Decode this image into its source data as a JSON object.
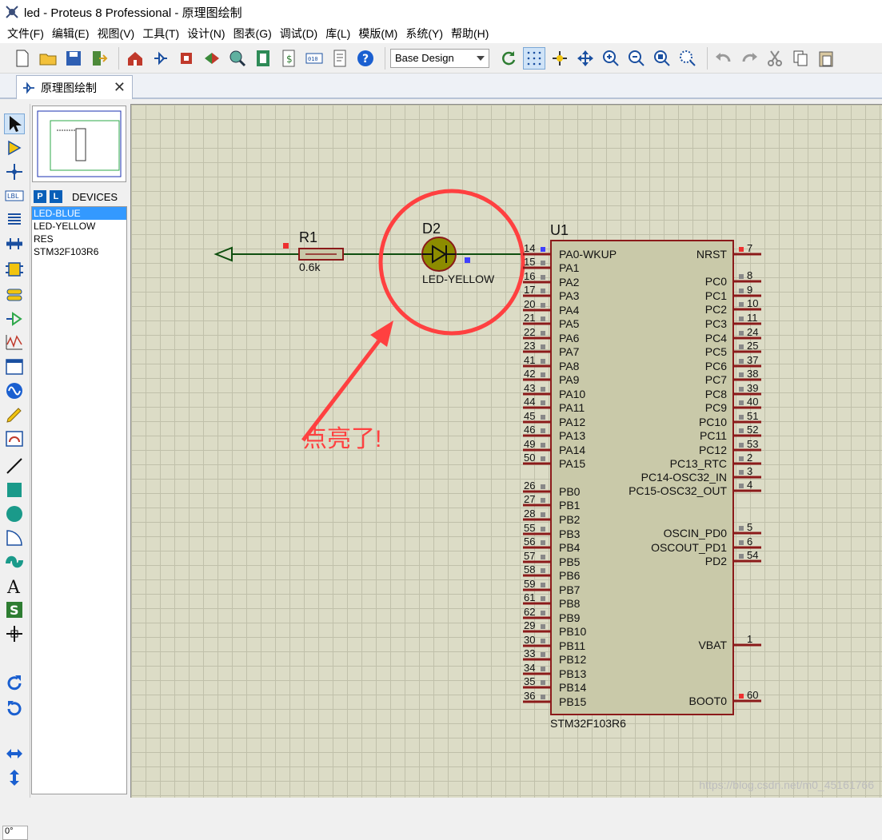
{
  "window": {
    "title": "led - Proteus 8 Professional - 原理图绘制"
  },
  "menu": [
    "文件(F)",
    "编辑(E)",
    "视图(V)",
    "工具(T)",
    "设计(N)",
    "图表(G)",
    "调试(D)",
    "库(L)",
    "模版(M)",
    "系统(Y)",
    "帮助(H)"
  ],
  "toolbar": {
    "design_combo": "Base Design"
  },
  "tab": {
    "label": "原理图绘制",
    "close": "✕"
  },
  "devices": {
    "p_btn": "P",
    "l_btn": "L",
    "header": "DEVICES",
    "items": [
      "LED-BLUE",
      "LED-YELLOW",
      "RES",
      "STM32F103R6"
    ]
  },
  "angle": "0°",
  "schematic": {
    "r1_ref": "R1",
    "r1_val": "0.6k",
    "d2_ref": "D2",
    "d2_val": "LED-YELLOW",
    "u1_ref": "U1",
    "u1_part": "STM32F103R6",
    "annotation": "点亮了!",
    "left_pins": [
      {
        "num": "14",
        "name": "PA0-WKUP"
      },
      {
        "num": "15",
        "name": "PA1"
      },
      {
        "num": "16",
        "name": "PA2"
      },
      {
        "num": "17",
        "name": "PA3"
      },
      {
        "num": "20",
        "name": "PA4"
      },
      {
        "num": "21",
        "name": "PA5"
      },
      {
        "num": "22",
        "name": "PA6"
      },
      {
        "num": "23",
        "name": "PA7"
      },
      {
        "num": "41",
        "name": "PA8"
      },
      {
        "num": "42",
        "name": "PA9"
      },
      {
        "num": "43",
        "name": "PA10"
      },
      {
        "num": "44",
        "name": "PA11"
      },
      {
        "num": "45",
        "name": "PA12"
      },
      {
        "num": "46",
        "name": "PA13"
      },
      {
        "num": "49",
        "name": "PA14"
      },
      {
        "num": "50",
        "name": "PA15"
      },
      {
        "num": "26",
        "name": "PB0"
      },
      {
        "num": "27",
        "name": "PB1"
      },
      {
        "num": "28",
        "name": "PB2"
      },
      {
        "num": "55",
        "name": "PB3"
      },
      {
        "num": "56",
        "name": "PB4"
      },
      {
        "num": "57",
        "name": "PB5"
      },
      {
        "num": "58",
        "name": "PB6"
      },
      {
        "num": "59",
        "name": "PB7"
      },
      {
        "num": "61",
        "name": "PB8"
      },
      {
        "num": "62",
        "name": "PB9"
      },
      {
        "num": "29",
        "name": "PB10"
      },
      {
        "num": "30",
        "name": "PB11"
      },
      {
        "num": "33",
        "name": "PB12"
      },
      {
        "num": "34",
        "name": "PB13"
      },
      {
        "num": "35",
        "name": "PB14"
      },
      {
        "num": "36",
        "name": "PB15"
      }
    ],
    "right_pins": [
      {
        "num": "7",
        "name": "NRST"
      },
      {
        "num": "8",
        "name": "PC0"
      },
      {
        "num": "9",
        "name": "PC1"
      },
      {
        "num": "10",
        "name": "PC2"
      },
      {
        "num": "11",
        "name": "PC3"
      },
      {
        "num": "24",
        "name": "PC4"
      },
      {
        "num": "25",
        "name": "PC5"
      },
      {
        "num": "37",
        "name": "PC6"
      },
      {
        "num": "38",
        "name": "PC7"
      },
      {
        "num": "39",
        "name": "PC8"
      },
      {
        "num": "40",
        "name": "PC9"
      },
      {
        "num": "51",
        "name": "PC10"
      },
      {
        "num": "52",
        "name": "PC11"
      },
      {
        "num": "53",
        "name": "PC12"
      },
      {
        "num": "2",
        "name": "PC13_RTC"
      },
      {
        "num": "3",
        "name": "PC14-OSC32_IN"
      },
      {
        "num": "4",
        "name": "PC15-OSC32_OUT"
      },
      {
        "num": "5",
        "name": "OSCIN_PD0"
      },
      {
        "num": "6",
        "name": "OSCOUT_PD1"
      },
      {
        "num": "54",
        "name": "PD2"
      },
      {
        "num": "1",
        "name": "VBAT"
      },
      {
        "num": "60",
        "name": "BOOT0"
      }
    ]
  },
  "watermark": "https://blog.csdn.net/m0_45161766",
  "colors": {
    "canvas": "#dcdcc6",
    "wire": "#0f4f0f",
    "pin": "#8b1a1a",
    "chip_fill": "#c9c9a9",
    "led_fill": "#8c8c00",
    "annotation": "#ff4040"
  }
}
